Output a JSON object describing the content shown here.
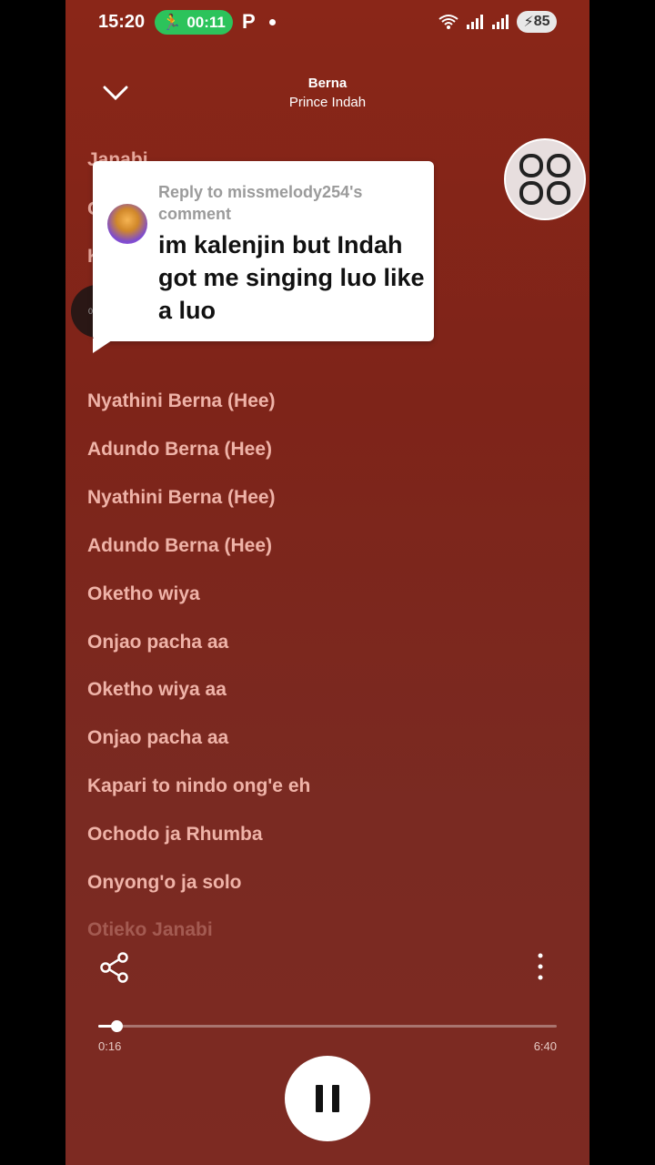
{
  "status_bar": {
    "time": "15:20",
    "timer": "00:11",
    "p_label": "P",
    "battery": "85"
  },
  "header": {
    "title": "Berna",
    "artist": "Prince Indah"
  },
  "comment": {
    "reply_to": "Reply to missmelody254's comment",
    "text": "im kalenjin but Indah got me singing luo like a luo"
  },
  "hidden_lyrics": {
    "first": "Janabi",
    "second": "O",
    "third": "K",
    "fourth": "0"
  },
  "lyrics": [
    "Nyathini Berna (Hee)",
    "Adundo Berna (Hee)",
    "Nyathini Berna (Hee)",
    "Adundo Berna (Hee)",
    "Oketho wiya",
    "Onjao pacha aa",
    "Oketho wiya aa",
    "Onjao pacha aa",
    "Kapari to nindo ong'e eh",
    "Ochodo ja Rhumba",
    "Onyong'o ja solo",
    "Otieko Janabi"
  ],
  "player": {
    "elapsed": "0:16",
    "total": "6:40",
    "progress_fraction": 0.04
  },
  "colors": {
    "background": "#7e2419",
    "lyric": "#efb3a8",
    "timer_pill": "#2cc35b"
  }
}
